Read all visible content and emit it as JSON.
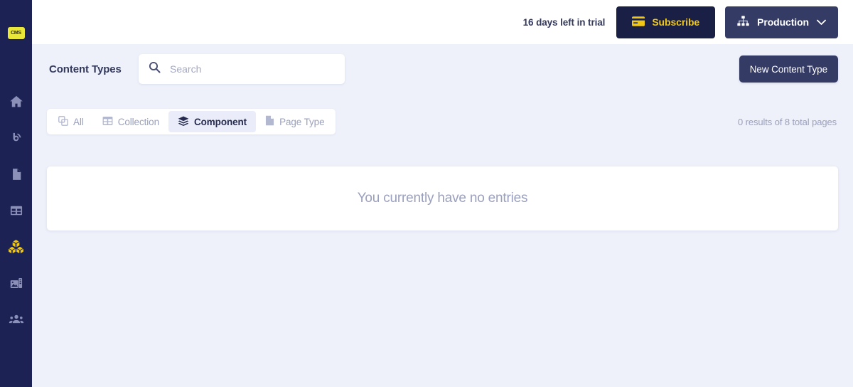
{
  "sidebar": {
    "logo_text": "CMS",
    "logo_color": "#e9e73a",
    "items": [
      {
        "name": "home",
        "icon": "home-icon",
        "active": false
      },
      {
        "name": "broadcast",
        "icon": "broadcast-icon",
        "active": false
      },
      {
        "name": "pages",
        "icon": "document-icon",
        "active": false
      },
      {
        "name": "collections",
        "icon": "table-grid-icon",
        "active": false
      },
      {
        "name": "components",
        "icon": "cubes-icon",
        "active": true
      },
      {
        "name": "media",
        "icon": "media-image-icon",
        "active": false
      },
      {
        "name": "users",
        "icon": "users-icon",
        "active": false
      }
    ]
  },
  "topbar": {
    "trial_text": "16 days left in trial",
    "subscribe_label": "Subscribe",
    "subscribe_icon": "credit-card-icon",
    "subscribe_bg": "#191f45",
    "subscribe_fg": "#f2c816",
    "environment_label": "Production",
    "environment_icon": "sitemap-icon",
    "environment_chevron": "chevron-down-icon",
    "environment_bg": "#343b65"
  },
  "header": {
    "page_title": "Content Types",
    "new_content_type_label": "New Content Type"
  },
  "search": {
    "placeholder": "Search",
    "value": "",
    "icon": "search-icon"
  },
  "filters": {
    "tabs": [
      {
        "label": "All",
        "icon": "copy-icon",
        "active": false
      },
      {
        "label": "Collection",
        "icon": "table-icon",
        "active": false
      },
      {
        "label": "Component",
        "icon": "layers-icon",
        "active": true
      },
      {
        "label": "Page Type",
        "icon": "page-icon",
        "active": false
      }
    ],
    "results_text": "0 results of 8 total pages"
  },
  "empty_state": {
    "message": "You currently have no entries"
  }
}
